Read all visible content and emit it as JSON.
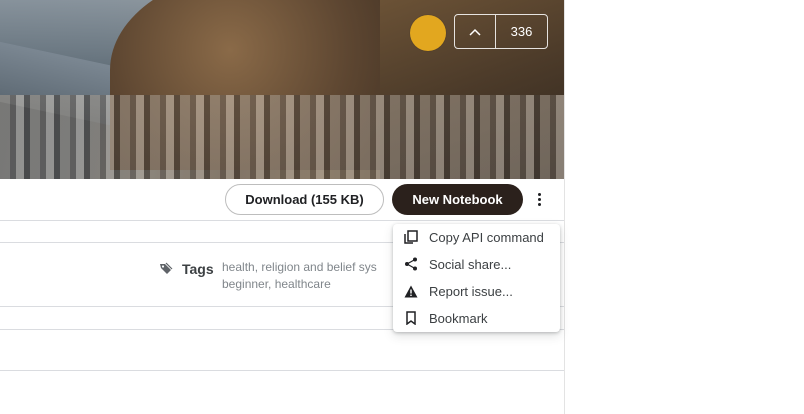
{
  "header": {
    "vote_count": "336",
    "avatar_color": "#e2a71f"
  },
  "actions": {
    "download_label": "Download (155 KB)",
    "new_notebook_label": "New Notebook"
  },
  "metadata": {
    "tags_label": "Tags",
    "tags_line1": "health, religion and belief sys",
    "tags_line2": "beginner, healthcare"
  },
  "menu": {
    "items": [
      {
        "label": "Copy API command",
        "icon": "copy-icon"
      },
      {
        "label": "Social share...",
        "icon": "share-icon"
      },
      {
        "label": "Report issue...",
        "icon": "warning-icon"
      },
      {
        "label": "Bookmark",
        "icon": "bookmark-icon"
      }
    ]
  },
  "colors": {
    "primary_button": "#2b211c",
    "accent_avatar": "#e2a71f"
  }
}
